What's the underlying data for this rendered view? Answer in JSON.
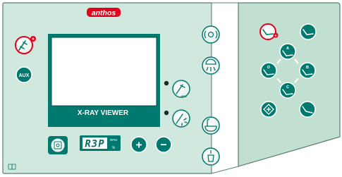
{
  "brand": {
    "logo_text": "anthos"
  },
  "colors": {
    "panel_bg": "#d1e8de",
    "panel_bg_right": "#c2e0d2",
    "panel_border": "#5c7d70",
    "teal": "#00796f",
    "teal_dark": "#005e56",
    "red": "#e3001b",
    "display_bg": "#ffffff",
    "lcd_segments": "#0c6f64"
  },
  "viewer": {
    "title": "X-RAY VIEWER"
  },
  "speed_display": {
    "value": "R3P",
    "unit_top": "RPM",
    "unit_bottom": "%"
  },
  "buttons": {
    "aux_label": "AUX",
    "plus_label": "+",
    "minus_label": "−",
    "rev_label": "REV",
    "chair_a": "A",
    "chair_b": "B",
    "chair_c": "C",
    "chair_d": "D"
  }
}
